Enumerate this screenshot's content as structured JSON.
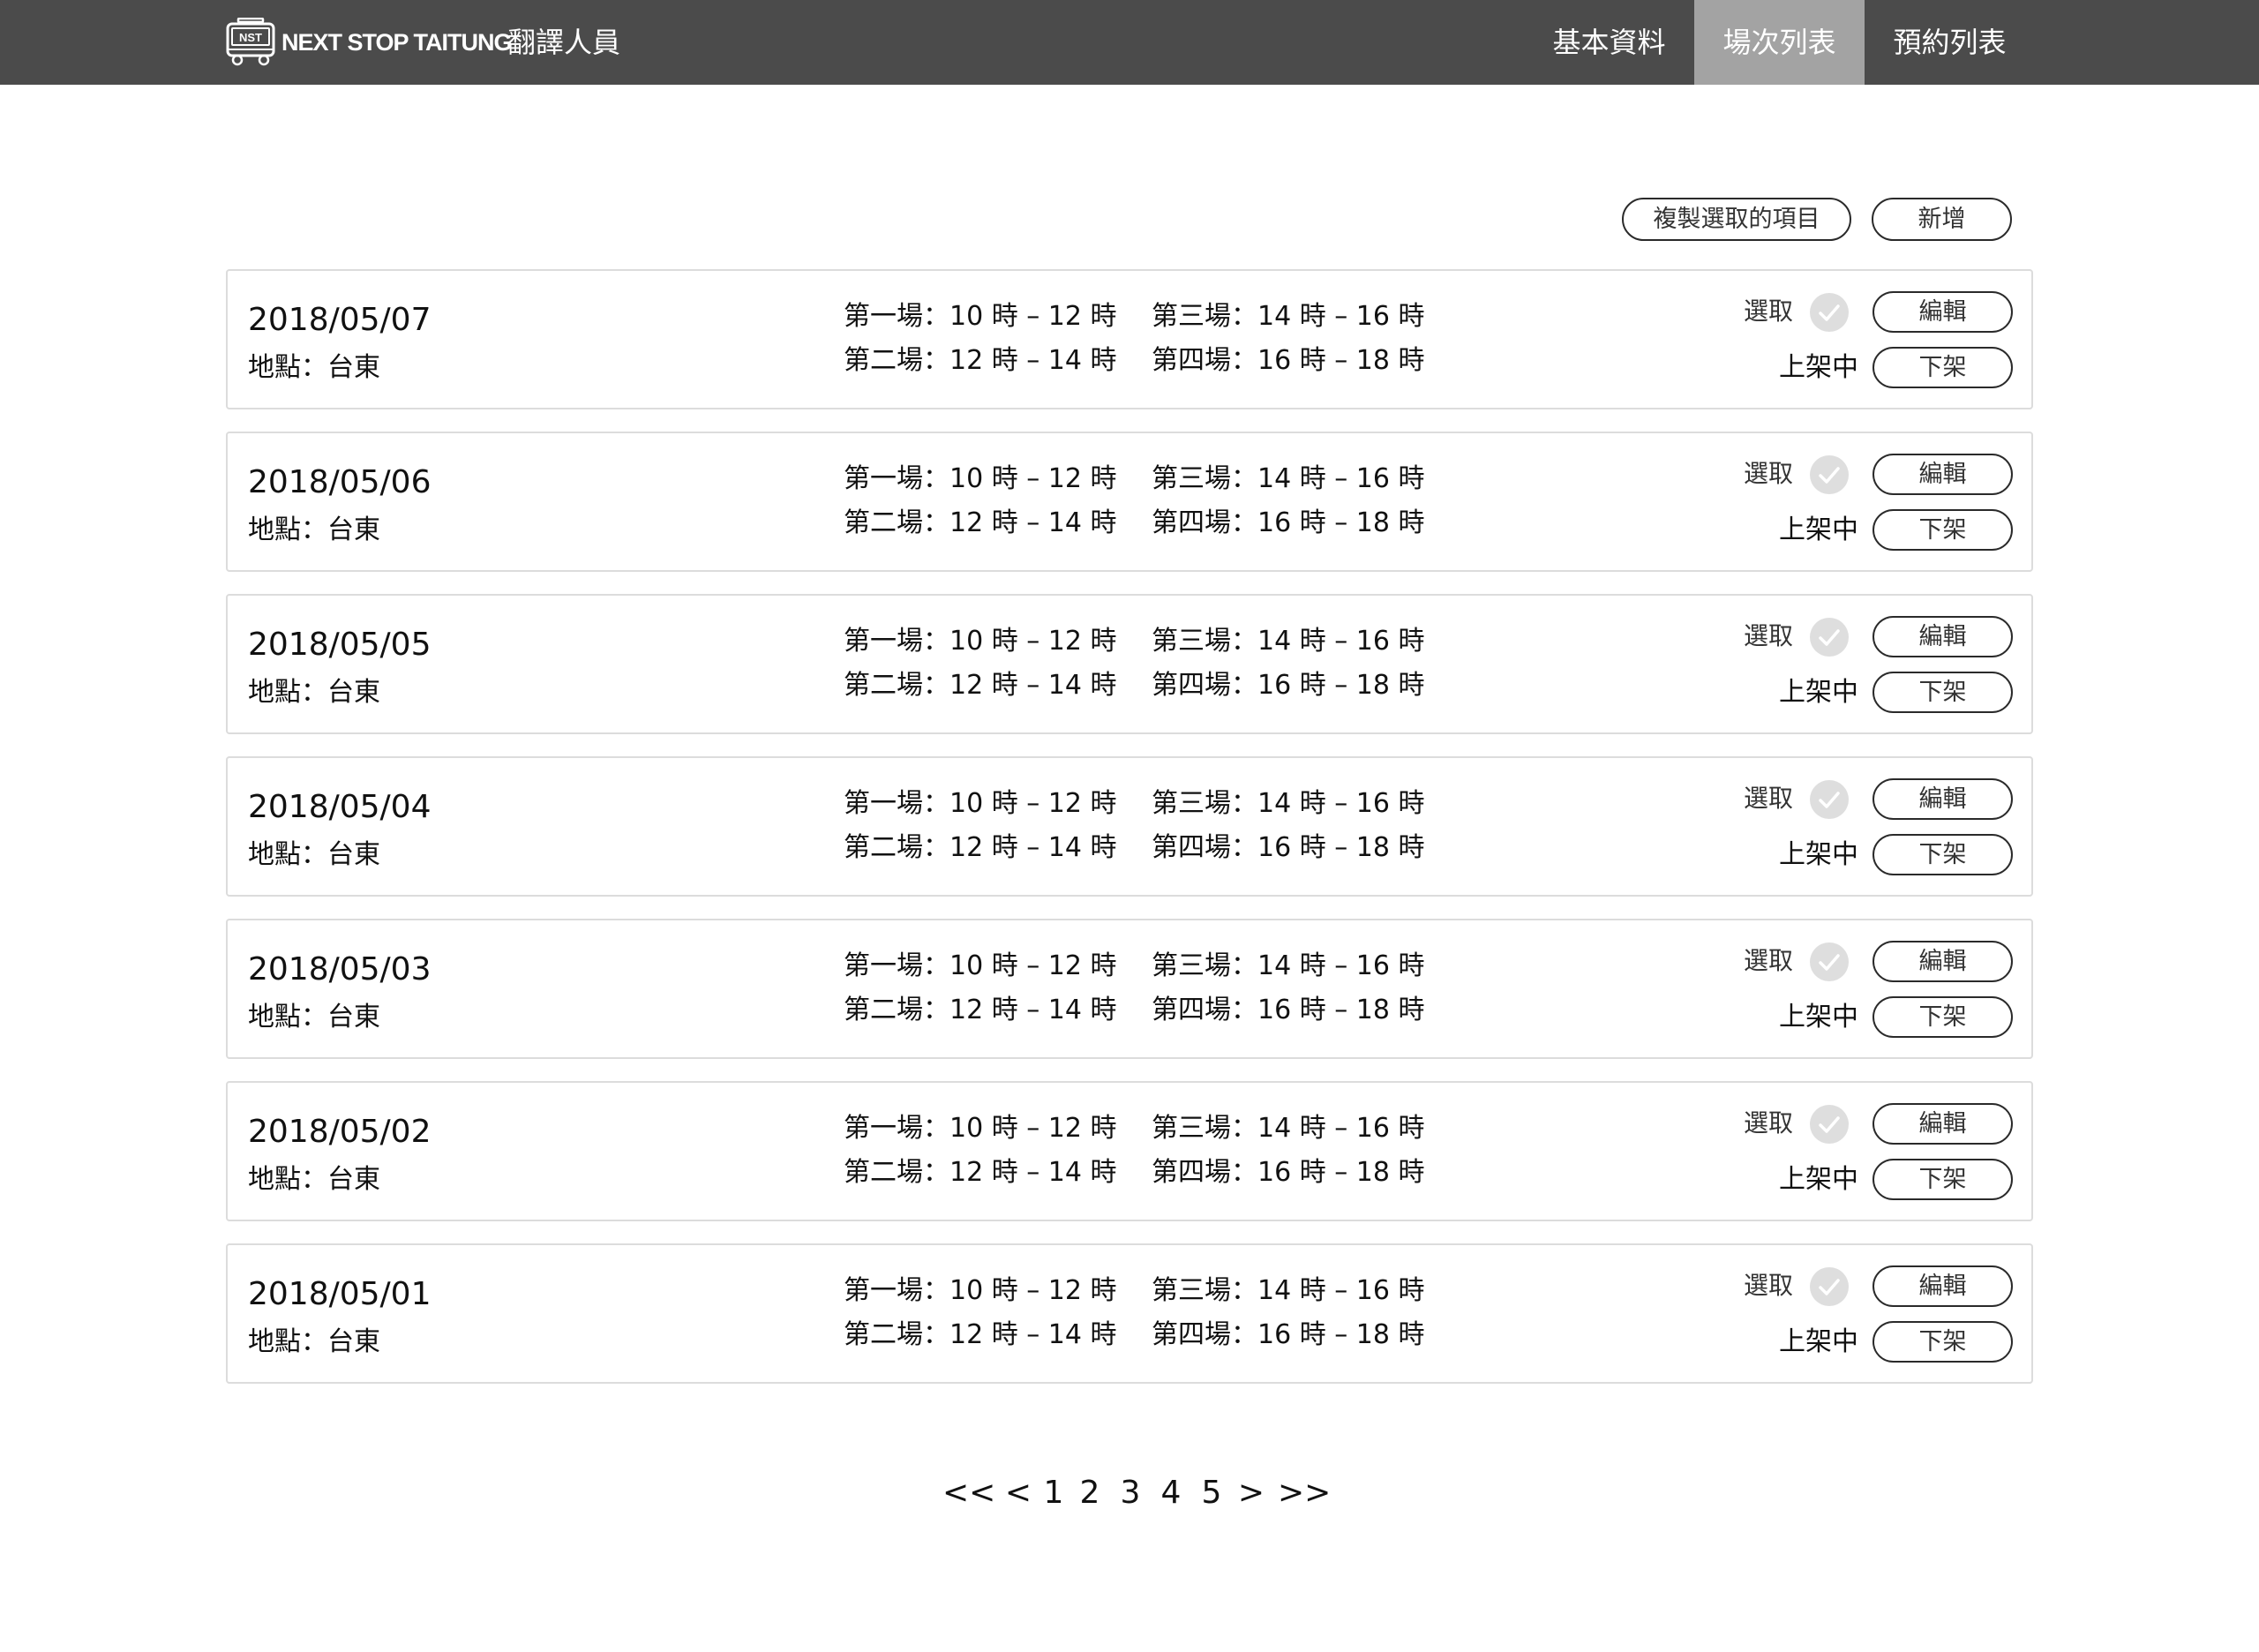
{
  "header": {
    "brand": "NEXT STOP TAITUNG",
    "role": "翻譯人員",
    "logo_icon": "train-icon",
    "logo_text": "NST",
    "nav": [
      {
        "label": "基本資料",
        "active": false
      },
      {
        "label": "場次列表",
        "active": true
      },
      {
        "label": "預約列表",
        "active": false
      }
    ]
  },
  "toolbar": {
    "copy_label": "複製選取的項目",
    "add_label": "新增"
  },
  "rows": [
    {
      "date": "2018/05/07",
      "location": "地點：台東",
      "sessions": [
        "第一場：10 時 – 12 時",
        "第二場：12 時 – 14 時",
        "第三場：14 時 – 16 時",
        "第四場：16 時 – 18 時"
      ],
      "select_label": "選取",
      "status": "上架中",
      "edit_label": "編輯",
      "unpublish_label": "下架"
    },
    {
      "date": "2018/05/06",
      "location": "地點：台東",
      "sessions": [
        "第一場：10 時 – 12 時",
        "第二場：12 時 – 14 時",
        "第三場：14 時 – 16 時",
        "第四場：16 時 – 18 時"
      ],
      "select_label": "選取",
      "status": "上架中",
      "edit_label": "編輯",
      "unpublish_label": "下架"
    },
    {
      "date": "2018/05/05",
      "location": "地點：台東",
      "sessions": [
        "第一場：10 時 – 12 時",
        "第二場：12 時 – 14 時",
        "第三場：14 時 – 16 時",
        "第四場：16 時 – 18 時"
      ],
      "select_label": "選取",
      "status": "上架中",
      "edit_label": "編輯",
      "unpublish_label": "下架"
    },
    {
      "date": "2018/05/04",
      "location": "地點：台東",
      "sessions": [
        "第一場：10 時 – 12 時",
        "第二場：12 時 – 14 時",
        "第三場：14 時 – 16 時",
        "第四場：16 時 – 18 時"
      ],
      "select_label": "選取",
      "status": "上架中",
      "edit_label": "編輯",
      "unpublish_label": "下架"
    },
    {
      "date": "2018/05/03",
      "location": "地點：台東",
      "sessions": [
        "第一場：10 時 – 12 時",
        "第二場：12 時 – 14 時",
        "第三場：14 時 – 16 時",
        "第四場：16 時 – 18 時"
      ],
      "select_label": "選取",
      "status": "上架中",
      "edit_label": "編輯",
      "unpublish_label": "下架"
    },
    {
      "date": "2018/05/02",
      "location": "地點：台東",
      "sessions": [
        "第一場：10 時 – 12 時",
        "第二場：12 時 – 14 時",
        "第三場：14 時 – 16 時",
        "第四場：16 時 – 18 時"
      ],
      "select_label": "選取",
      "status": "上架中",
      "edit_label": "編輯",
      "unpublish_label": "下架"
    },
    {
      "date": "2018/05/01",
      "location": "地點：台東",
      "sessions": [
        "第一場：10 時 – 12 時",
        "第二場：12 時 – 14 時",
        "第三場：14 時 – 16 時",
        "第四場：16 時 – 18 時"
      ],
      "select_label": "選取",
      "status": "上架中",
      "edit_label": "編輯",
      "unpublish_label": "下架"
    }
  ],
  "pagination": {
    "first": "<<",
    "prev": "<",
    "pages": [
      "1",
      "2",
      "3",
      "4",
      "5"
    ],
    "next": ">",
    "last": ">>"
  },
  "colors": {
    "topbar": "#4b4b4b",
    "nav_active": "#a3a3a3",
    "card_border": "#dcdcdc",
    "check_circle": "#dedede"
  }
}
